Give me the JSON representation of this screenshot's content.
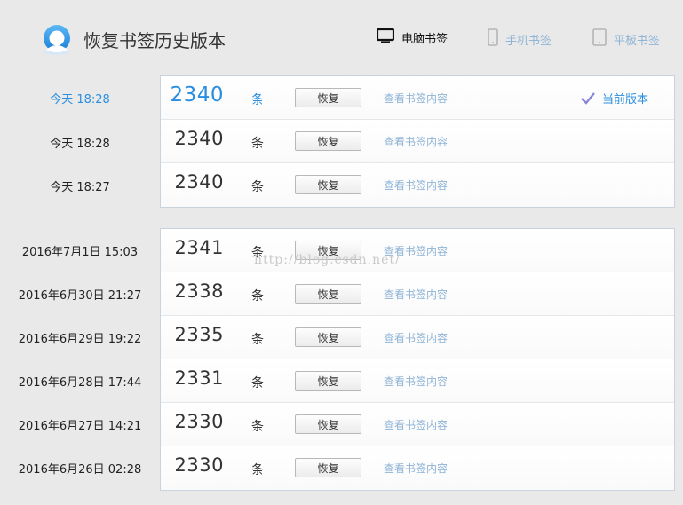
{
  "header": {
    "title": "恢复书签历史版本",
    "tabs": [
      {
        "label": "电脑书签",
        "icon": "monitor-icon",
        "active": true
      },
      {
        "label": "手机书签",
        "icon": "phone-icon",
        "active": false
      },
      {
        "label": "平板书签",
        "icon": "tablet-icon",
        "active": false
      }
    ]
  },
  "unit": "条",
  "restore_label": "恢复",
  "view_label": "查看书签内容",
  "current_label": "当前版本",
  "groups": [
    {
      "rows": [
        {
          "date": "今天 18:28",
          "count": "2340",
          "current": true
        },
        {
          "date": "今天 18:28",
          "count": "2340"
        },
        {
          "date": "今天 18:27",
          "count": "2340"
        }
      ]
    },
    {
      "rows": [
        {
          "date": "2016年7月1日 15:03",
          "count": "2341"
        },
        {
          "date": "2016年6月30日 21:27",
          "count": "2338"
        },
        {
          "date": "2016年6月29日 19:22",
          "count": "2335"
        },
        {
          "date": "2016年6月28日 17:44",
          "count": "2331"
        },
        {
          "date": "2016年6月27日 14:21",
          "count": "2330"
        },
        {
          "date": "2016年6月26日 02:28",
          "count": "2330"
        }
      ]
    }
  ],
  "watermark": "http://blog.csdn.net/",
  "colors": {
    "accent": "#2a8ee0",
    "link": "#8fb4d6",
    "background": "#e9e9e9"
  }
}
